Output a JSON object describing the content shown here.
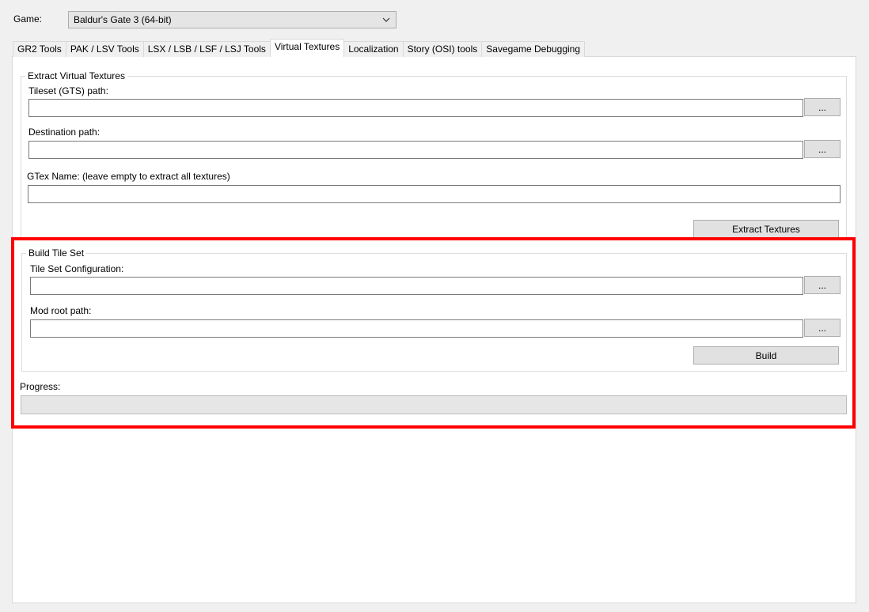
{
  "game": {
    "label": "Game:",
    "selected": "Baldur's Gate 3 (64-bit)"
  },
  "tabs": [
    {
      "label": "GR2 Tools"
    },
    {
      "label": "PAK / LSV Tools"
    },
    {
      "label": "LSX / LSB / LSF / LSJ Tools"
    },
    {
      "label": "Virtual Textures"
    },
    {
      "label": "Localization"
    },
    {
      "label": "Story (OSI) tools"
    },
    {
      "label": "Savegame Debugging"
    }
  ],
  "extract": {
    "title": "Extract Virtual Textures",
    "tileset_label": "Tileset (GTS) path:",
    "tileset_value": "",
    "destination_label": "Destination path:",
    "destination_value": "",
    "gtex_label": "GTex Name: (leave empty to extract all textures)",
    "gtex_value": "",
    "browse_label": "...",
    "extract_button": "Extract Textures"
  },
  "build": {
    "title": "Build Tile Set",
    "config_label": "Tile Set Configuration:",
    "config_value": "",
    "modroot_label": "Mod root path:",
    "modroot_value": "",
    "browse_label": "...",
    "build_button": "Build"
  },
  "progress": {
    "label": "Progress:",
    "value": 0
  },
  "colors": {
    "highlight": "#ff0000"
  }
}
